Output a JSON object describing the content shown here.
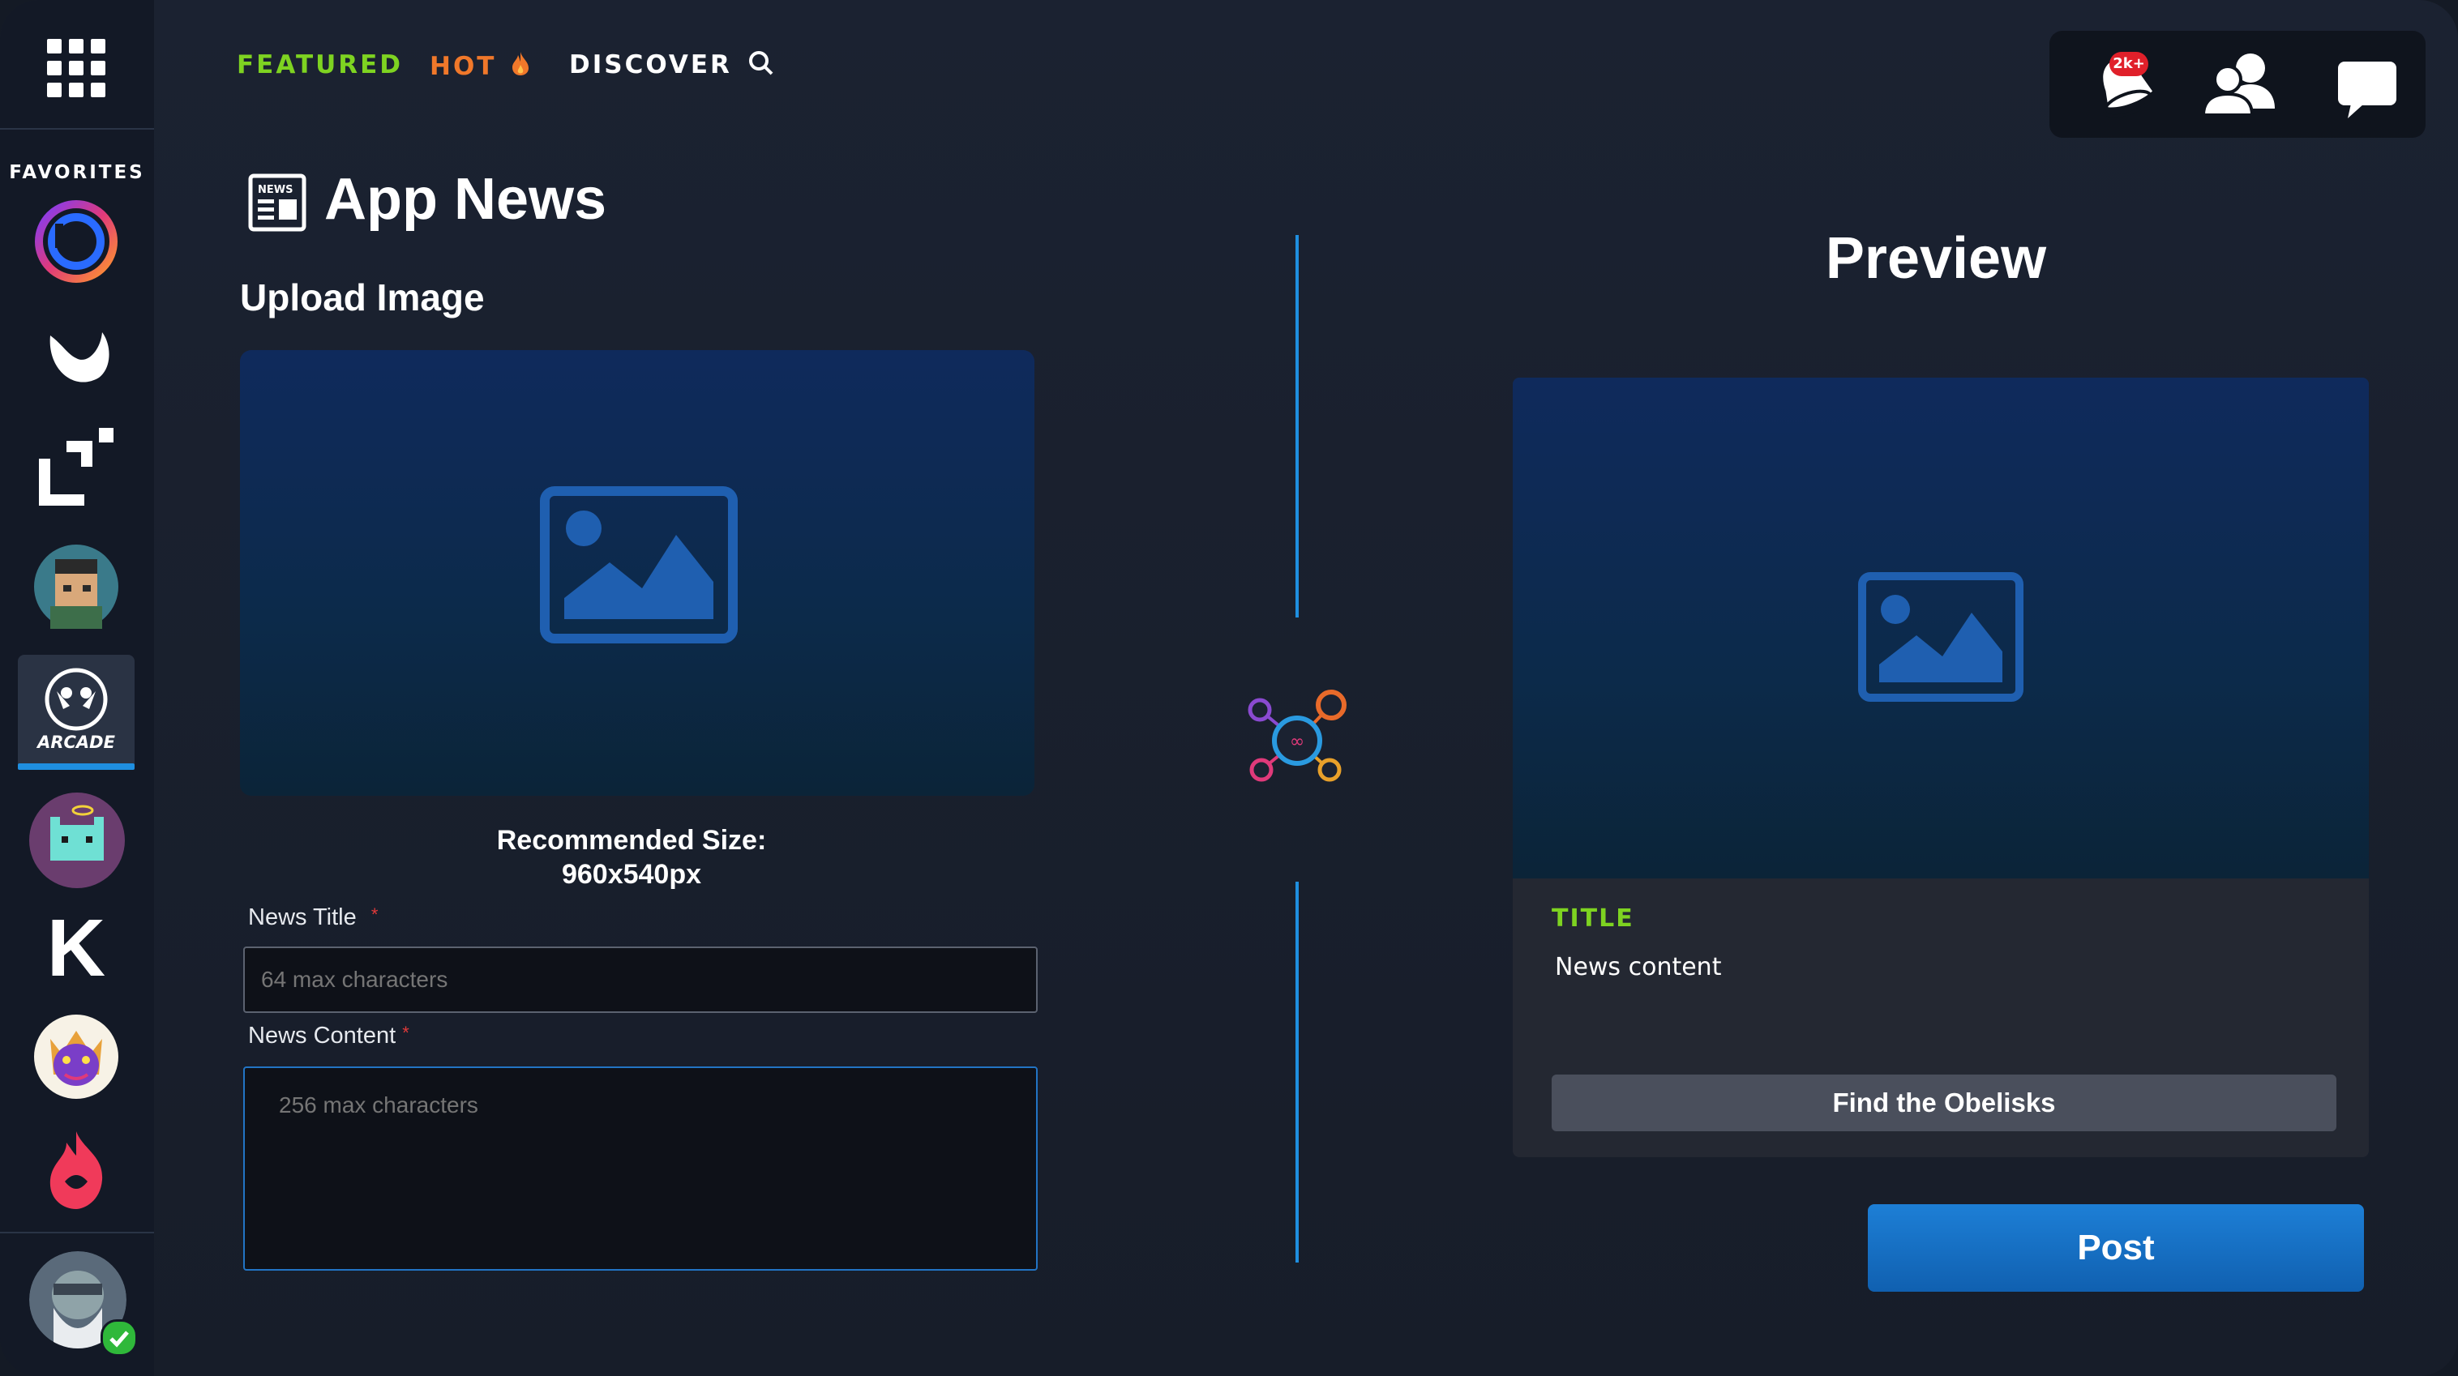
{
  "nav": {
    "featured": "FEATURED",
    "hot": "HOT",
    "discover": "DISCOVER"
  },
  "notifications": {
    "badge": "2k+"
  },
  "sidebar": {
    "favorites_label": "FAVORITES",
    "arcade_label": "ARCADE",
    "k_letter": "K"
  },
  "main": {
    "title": "App News",
    "news_icon_text": "NEWS",
    "upload_label": "Upload Image",
    "recommended_line1": "Recommended Size:",
    "recommended_line2": "960x540px",
    "news_title_label": "News Title",
    "news_title_placeholder": "64 max characters",
    "news_content_label": "News Content",
    "news_content_placeholder": "256 max characters",
    "required_mark": "*"
  },
  "preview": {
    "heading": "Preview",
    "card_title": "TITLE",
    "card_content": "News content",
    "card_button": "Find the Obelisks",
    "post_button": "Post"
  },
  "colors": {
    "featured": "#7ed321",
    "hot": "#f0782a",
    "accent_blue": "#1f8fe0",
    "title_green": "#7ed321"
  }
}
